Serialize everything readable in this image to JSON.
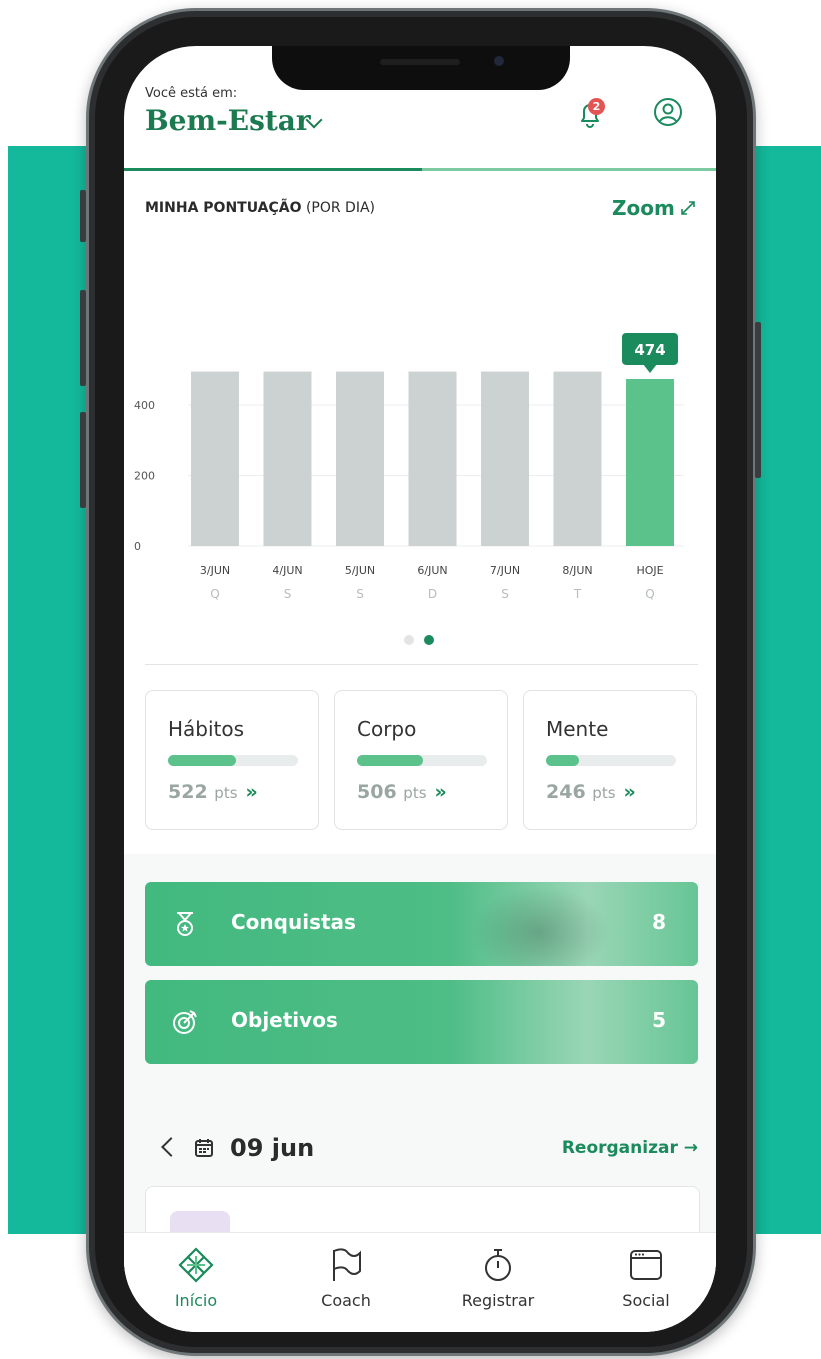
{
  "header": {
    "location_prefix": "Você está em:",
    "location": "Bem-Estar",
    "notification_count": "2"
  },
  "score": {
    "title_bold": "MINHA PONTUAÇÃO",
    "title_rest": "(POR DIA)",
    "zoom_label": "Zoom"
  },
  "chart_data": {
    "type": "bar",
    "categories": [
      "3/JUN",
      "4/JUN",
      "5/JUN",
      "6/JUN",
      "7/JUN",
      "8/JUN",
      "HOJE"
    ],
    "weekdays": [
      "Q",
      "S",
      "S",
      "D",
      "S",
      "T",
      "Q"
    ],
    "values": [
      495,
      495,
      495,
      495,
      495,
      495,
      474
    ],
    "highlight_index": 6,
    "highlight_label": "474",
    "yticks": [
      0,
      200,
      400
    ],
    "ylim": [
      0,
      500
    ],
    "colors": {
      "bar": "#ccd2d1",
      "highlight": "#5bc28c",
      "label_bg": "#1b8a5c"
    },
    "grid": true
  },
  "pagination": {
    "pages": 2,
    "active": 2
  },
  "categories": [
    {
      "name": "Hábitos",
      "points": "522",
      "unit": "pts",
      "progress": 0.52
    },
    {
      "name": "Corpo",
      "points": "506",
      "unit": "pts",
      "progress": 0.51
    },
    {
      "name": "Mente",
      "points": "246",
      "unit": "pts",
      "progress": 0.25
    }
  ],
  "banners": [
    {
      "label": "Conquistas",
      "count": "8",
      "icon": "medal-icon"
    },
    {
      "label": "Objetivos",
      "count": "5",
      "icon": "target-icon"
    }
  ],
  "day": {
    "date": "09 jun",
    "reorganize": "Reorganizar →"
  },
  "nav": [
    {
      "label": "Início",
      "icon": "home-diamond-icon",
      "active": true
    },
    {
      "label": "Coach",
      "icon": "flag-icon",
      "active": false
    },
    {
      "label": "Registrar",
      "icon": "stopwatch-icon",
      "active": false
    },
    {
      "label": "Social",
      "icon": "browser-window-icon",
      "active": false
    }
  ],
  "colors": {
    "accent": "#1b8a5c",
    "accent_light": "#5bc28c",
    "teal_bg": "#14b89a"
  }
}
